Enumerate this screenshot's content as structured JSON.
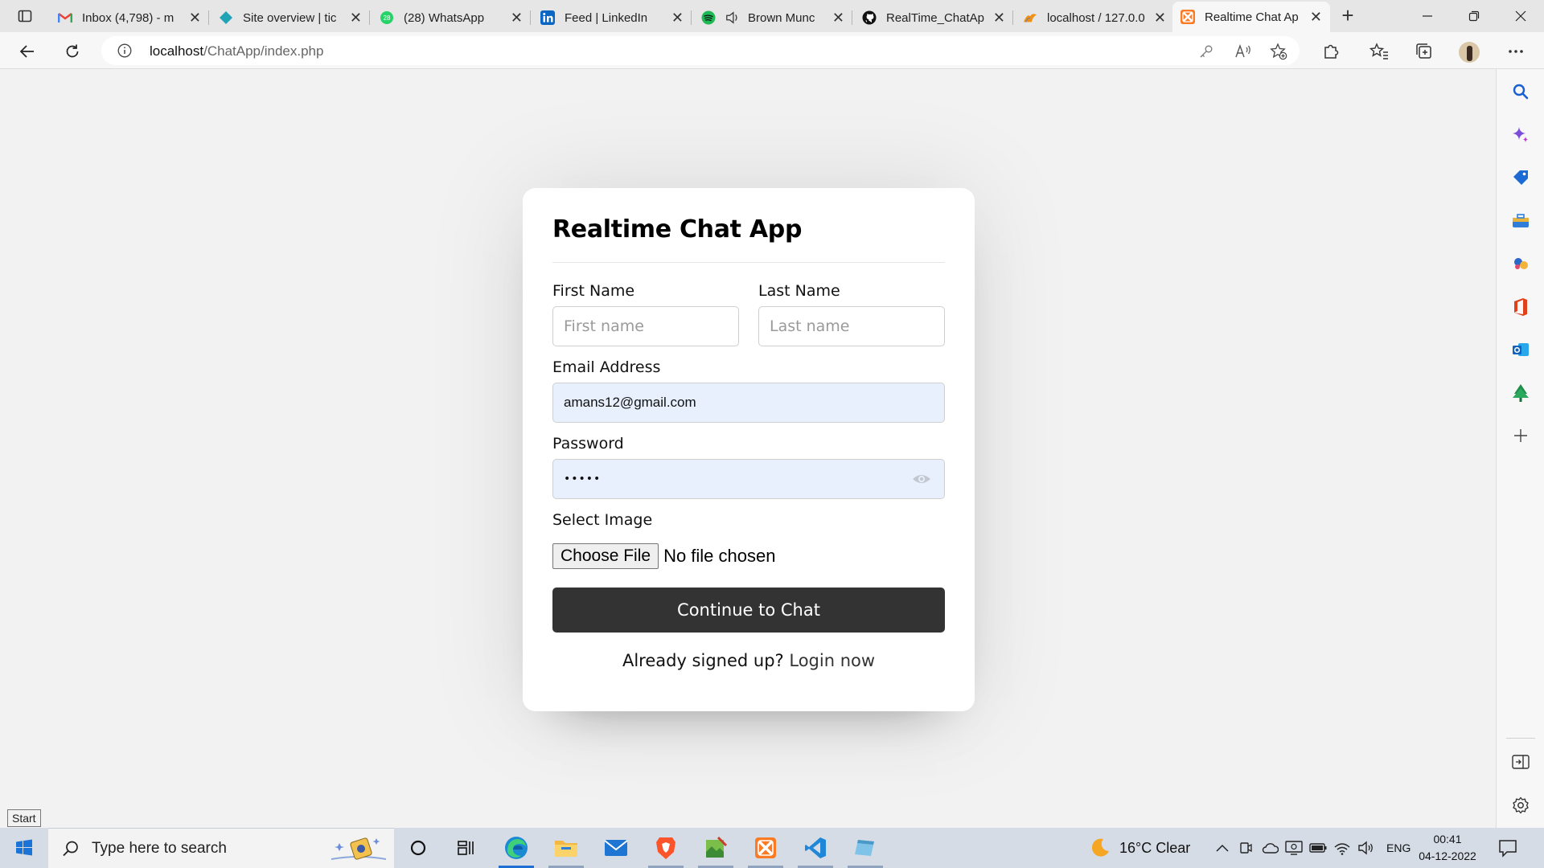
{
  "tabs": [
    {
      "title": "Inbox (4,798) - m",
      "icon": "gmail-icon",
      "close": "✕"
    },
    {
      "title": "Site overview | tic",
      "icon": "site-icon",
      "close": "✕"
    },
    {
      "title": "(28) WhatsApp",
      "icon": "whatsapp-icon",
      "badge": "28",
      "close": "✕"
    },
    {
      "title": "Feed | LinkedIn",
      "icon": "linkedin-icon",
      "close": "✕"
    },
    {
      "title": "Brown Munc",
      "icon": "spotify-icon",
      "close": "✕"
    },
    {
      "title": "RealTime_ChatAp",
      "icon": "github-icon",
      "close": "✕"
    },
    {
      "title": "localhost / 127.0.0",
      "icon": "phpmyadmin-icon",
      "close": "✕"
    },
    {
      "title": "Realtime Chat Ap",
      "icon": "xampp-icon",
      "close": "✕"
    }
  ],
  "address_bar": {
    "host": "localhost",
    "path": "/ChatApp/index.php"
  },
  "form": {
    "title": "Realtime Chat App",
    "first_name_label": "First Name",
    "first_name_placeholder": "First name",
    "last_name_label": "Last Name",
    "last_name_placeholder": "Last name",
    "email_label": "Email Address",
    "email_value": "amans12@gmail.com",
    "password_label": "Password",
    "password_mask": "•••••",
    "image_label": "Select Image",
    "choose_file": "Choose File",
    "no_file": "No file chosen",
    "submit": "Continue to Chat",
    "signed_up_text": "Already signed up?",
    "login_link": "Login now"
  },
  "tooltip": "Start",
  "taskbar": {
    "search_placeholder": "Type here to search",
    "apps": [
      "task-view",
      "widgets",
      "edge",
      "file-explorer",
      "mail",
      "brave",
      "notepad",
      "xampp",
      "vscode",
      "app"
    ]
  },
  "tray": {
    "weather": "16°C  Clear",
    "lang": "ENG",
    "time": "00:41",
    "date": "04-12-2022"
  }
}
